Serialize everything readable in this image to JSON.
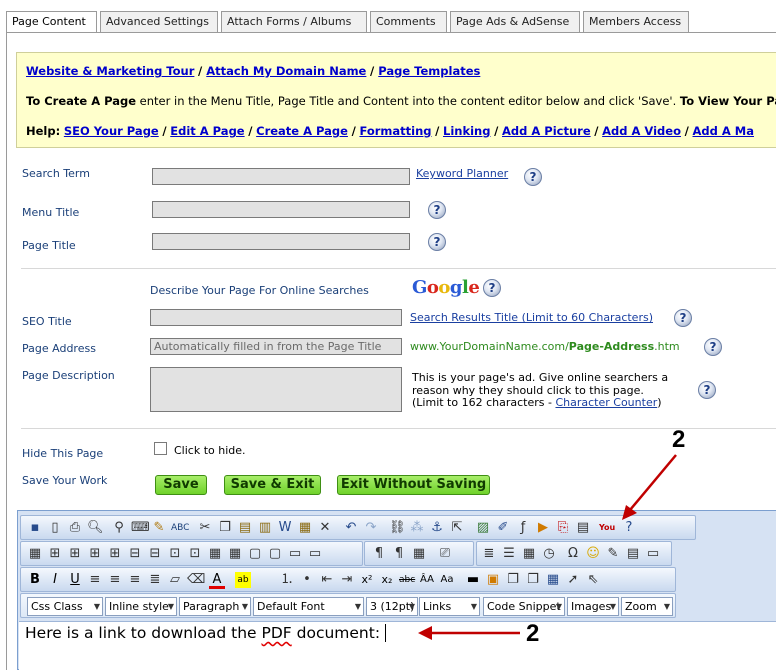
{
  "tabs": [
    "Page Content",
    "Advanced Settings",
    "Attach Forms / Albums",
    "Comments",
    "Page Ads & AdSense",
    "Members Access"
  ],
  "help": {
    "links_top": [
      "Website & Marketing Tour",
      "Attach My Domain Name",
      "Page Templates"
    ],
    "create_bold": "To Create A Page",
    "create_text": " enter in the Menu Title, Page Title and Content into the content editor below and click 'Save'. ",
    "view_bold": "To View Your Pa",
    "help_label": "Help:",
    "help_links": [
      "SEO Your Page",
      "Edit A Page",
      "Create A Page",
      "Formatting",
      "Linking",
      "Add A Picture",
      "Add A Video",
      "Add A Ma"
    ]
  },
  "form": {
    "search_term_label": "Search Term",
    "keyword_planner": "Keyword Planner",
    "menu_title_label": "Menu Title",
    "page_title_label": "Page Title",
    "describe_text": "Describe Your Page For Online Searches",
    "google_letters": [
      "G",
      "o",
      "o",
      "g",
      "l",
      "e"
    ],
    "seo_title_label": "SEO Title",
    "seo_title_link": "Search Results Title (Limit to 60 Characters)",
    "page_address_label": "Page Address",
    "page_address_placeholder": "Automatically filled in from the Page Title",
    "domain_prefix": "www.YourDomainName.com/",
    "domain_bold": "Page-Address",
    "domain_suffix": ".htm",
    "page_desc_label": "Page Description",
    "desc_line1": "This is your page's ad. Give online searchers a",
    "desc_line2": "reason why they should click to this page.",
    "desc_line3_pre": "(Limit to 162 characters - ",
    "desc_line3_link": "Character Counter",
    "desc_line3_post": ")",
    "hide_label": "Hide This Page",
    "hide_checkbox_text": "Click to hide.",
    "save_work_label": "Save Your Work",
    "buttons": [
      "Save",
      "Save & Exit",
      "Exit Without Saving"
    ],
    "help_mark": "?"
  },
  "editor": {
    "dropdowns": [
      "Css Class",
      "Inline style",
      "Paragraph",
      "Default Font",
      "3 (12pt)",
      "Links",
      "Code Snippet",
      "Images",
      "Zoom"
    ],
    "content_pre": "Here is a link to download the ",
    "content_pdf": "PDF",
    "content_post": " document: "
  },
  "annotations": {
    "marker_top": "2",
    "marker_bottom": "2",
    "color": "#c00000"
  },
  "icons": {
    "row1": [
      "save-icon",
      "new-icon",
      "print-icon",
      "preview-icon",
      "find-icon",
      "find-replace-icon",
      "spellcheck-icon",
      "abc-icon",
      "cut-icon",
      "copy-icon",
      "paste-icon",
      "paste-text-icon",
      "paste-word-icon",
      "paste-html-icon",
      "delete-icon",
      "undo-icon",
      "redo-icon",
      "link-icon",
      "unlink-icon",
      "anchor-icon",
      "hyperlink-icon",
      "image-icon",
      "image-edit-icon",
      "flash-icon",
      "media-icon",
      "pdf-icon",
      "document-icon",
      "youtube-icon",
      "help-icon"
    ]
  }
}
